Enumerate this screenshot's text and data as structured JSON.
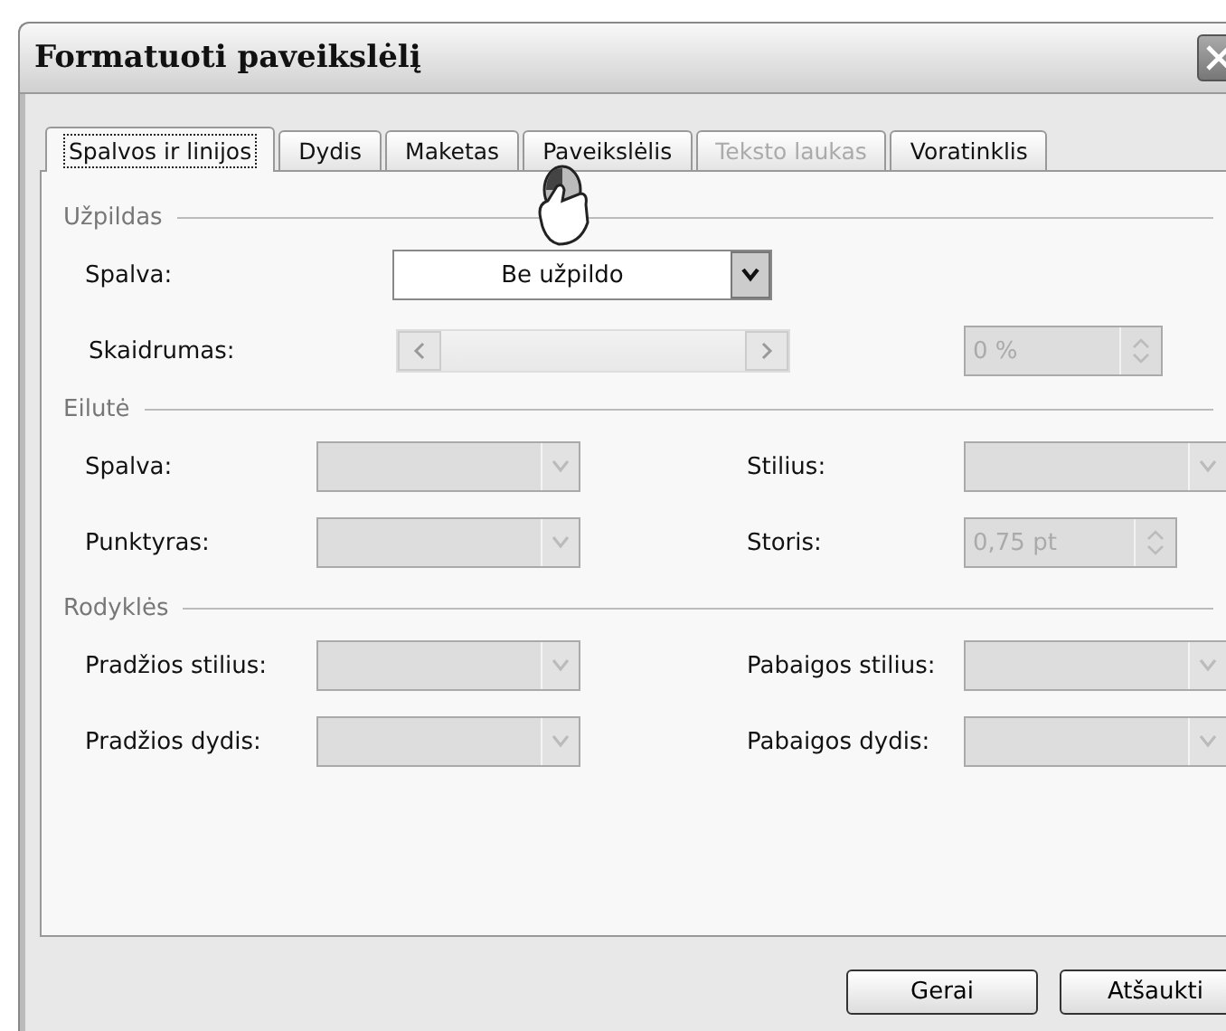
{
  "window": {
    "title": "Formatuoti paveikslėlį"
  },
  "tabs": [
    {
      "label": "Spalvos ir linijos",
      "selected": true,
      "disabled": false
    },
    {
      "label": "Dydis",
      "selected": false,
      "disabled": false
    },
    {
      "label": "Maketas",
      "selected": false,
      "disabled": false
    },
    {
      "label": "Paveikslėlis",
      "selected": false,
      "disabled": false
    },
    {
      "label": "Teksto laukas",
      "selected": false,
      "disabled": true
    },
    {
      "label": "Voratinklis",
      "selected": false,
      "disabled": false
    }
  ],
  "fill": {
    "heading": "Užpildas",
    "color": {
      "label": "Spalva:",
      "value": "Be užpildo",
      "disabled": false
    },
    "transparency": {
      "label": "Skaidrumas:",
      "value": "0 %",
      "disabled": true
    }
  },
  "line": {
    "heading": "Eilutė",
    "fields": [
      {
        "label": "Spalva:",
        "kind": "combo",
        "disabled": true
      },
      {
        "label": "Stilius:",
        "kind": "combo",
        "disabled": true
      },
      {
        "label": "Punktyras:",
        "kind": "combo",
        "disabled": true
      },
      {
        "label": "Storis:",
        "kind": "spin",
        "value": "0,75 pt",
        "disabled": true
      }
    ]
  },
  "arrows": {
    "heading": "Rodyklės",
    "fields": [
      {
        "label": "Pradžios stilius:",
        "kind": "combo",
        "disabled": true
      },
      {
        "label": "Pabaigos stilius:",
        "kind": "combo",
        "disabled": true
      },
      {
        "label": "Pradžios dydis:",
        "kind": "combo",
        "disabled": true
      },
      {
        "label": "Pabaigos dydis:",
        "kind": "combo",
        "disabled": true
      }
    ]
  },
  "buttons": [
    {
      "label": "Gerai"
    },
    {
      "label": "Atšaukti"
    }
  ]
}
